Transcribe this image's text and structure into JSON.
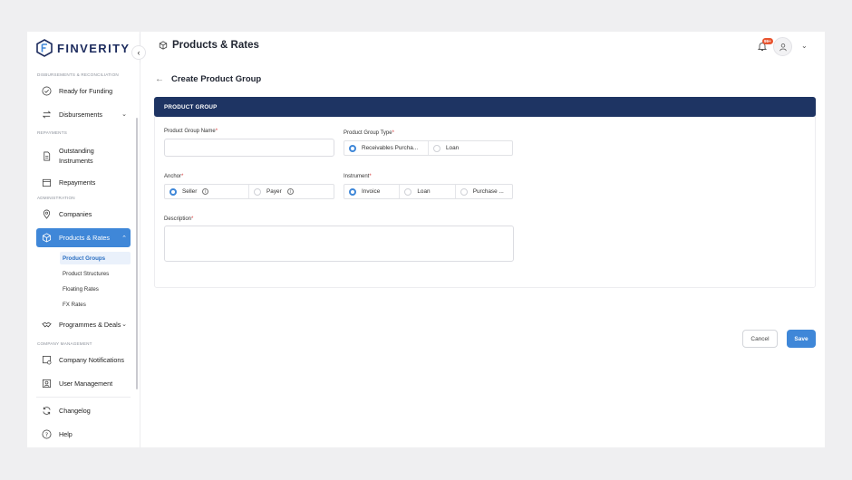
{
  "brand": {
    "name": "FINVERITY"
  },
  "sidebar": {
    "sections": {
      "disbursements": "DISBURSEMENTS & RECONCILIATION",
      "repayments": "REPAYMENTS",
      "administration": "ADMINISTRATION",
      "company_management": "COMPANY MANAGEMENT"
    },
    "items": {
      "ready_for_funding": "Ready for Funding",
      "disbursements": "Disbursements",
      "outstanding_instruments": "Outstanding Instruments",
      "repayments": "Repayments",
      "companies": "Companies",
      "products_rates": "Products & Rates",
      "programmes_deals": "Programmes & Deals",
      "company_notifications": "Company Notifications",
      "user_management": "User Management",
      "changelog": "Changelog",
      "help": "Help"
    },
    "sub_items": {
      "product_groups": "Product Groups",
      "product_structures": "Product Structures",
      "floating_rates": "Floating Rates",
      "fx_rates": "FX Rates"
    }
  },
  "header": {
    "title": "Products & Rates",
    "notification_count": "99+"
  },
  "page": {
    "title": "Create Product Group",
    "section_title": "PRODUCT GROUP"
  },
  "form": {
    "product_group_name": {
      "label": "Product Group Name",
      "value": ""
    },
    "product_group_type": {
      "label": "Product Group Type",
      "options": [
        "Receivables Purcha...",
        "Loan"
      ],
      "selected": "Receivables Purcha..."
    },
    "anchor": {
      "label": "Anchor",
      "options": [
        "Seller",
        "Payer"
      ],
      "selected": "Seller"
    },
    "instrument": {
      "label": "Instrument",
      "options": [
        "Invoice",
        "Loan",
        "Purchase ..."
      ],
      "selected": "Invoice"
    },
    "description": {
      "label": "Description",
      "value": ""
    },
    "required_mark": "*"
  },
  "actions": {
    "cancel": "Cancel",
    "save": "Save"
  },
  "colors": {
    "accent": "#3f87d8",
    "header_bar": "#1e3463",
    "badge": "#e8542f"
  }
}
